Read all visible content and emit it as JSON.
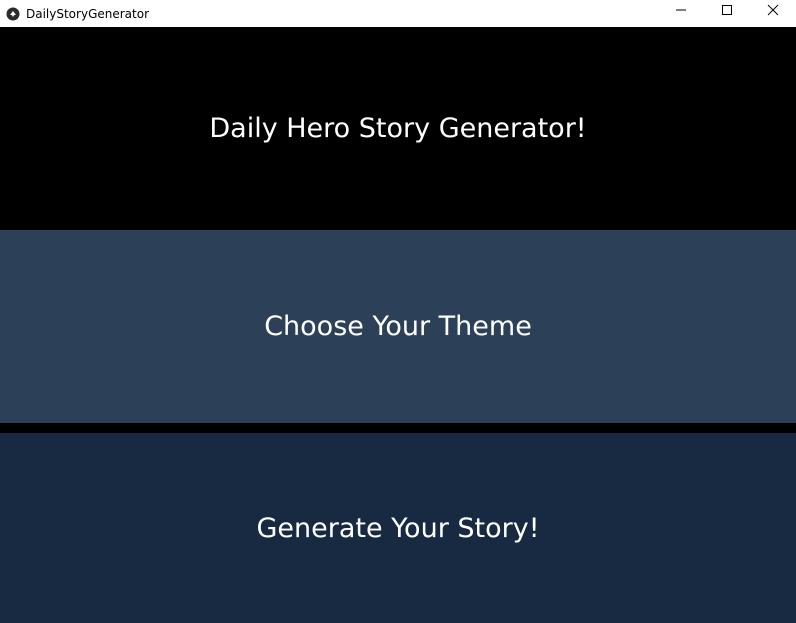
{
  "window": {
    "title": "DailyStoryGenerator"
  },
  "header": {
    "title": "Daily Hero Story Generator!"
  },
  "buttons": {
    "choose_theme": "Choose Your Theme",
    "generate_story": "Generate Your Story!"
  },
  "colors": {
    "header_bg": "#000000",
    "theme_button_bg": "#2c4158",
    "generate_button_bg": "#182a42",
    "text": "#ffffff"
  },
  "icons": {
    "app": "app-logo-icon",
    "minimize": "minimize-icon",
    "maximize": "maximize-icon",
    "close": "close-icon"
  }
}
